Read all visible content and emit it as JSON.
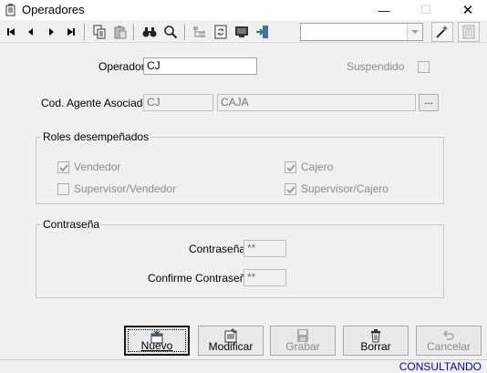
{
  "window": {
    "title": "Operadores"
  },
  "toolbar": {
    "combo_value": ""
  },
  "form": {
    "operador_label": "Operador",
    "operador_value": "CJ",
    "suspendido_label": "Suspendido",
    "suspendido_checked": false,
    "agente_label": "Cod. Agente Asociado",
    "agente_code": "CJ",
    "agente_name": "CAJA",
    "ellipsis": "..."
  },
  "roles": {
    "title": "Roles desempeñados",
    "items": [
      {
        "label": "Vendedor",
        "checked": true
      },
      {
        "label": "Cajero",
        "checked": true
      },
      {
        "label": "Supervisor/Vendedor",
        "checked": false
      },
      {
        "label": "Supervisor/Cajero",
        "checked": true
      }
    ]
  },
  "password": {
    "title": "Contraseña",
    "password_label": "Contraseña:",
    "password_value": "**",
    "confirm_label": "Confirme Contraseña:",
    "confirm_value": "**"
  },
  "buttons": {
    "nuevo": "Nuevo",
    "modificar": "Modificar",
    "grabar": "Grabar",
    "borrar": "Borrar",
    "cancelar": "Cancelar"
  },
  "status": {
    "text": "CONSULTANDO"
  },
  "colors": {
    "status_text": "#0000cc",
    "disabled_text": "#8c8c8c"
  }
}
